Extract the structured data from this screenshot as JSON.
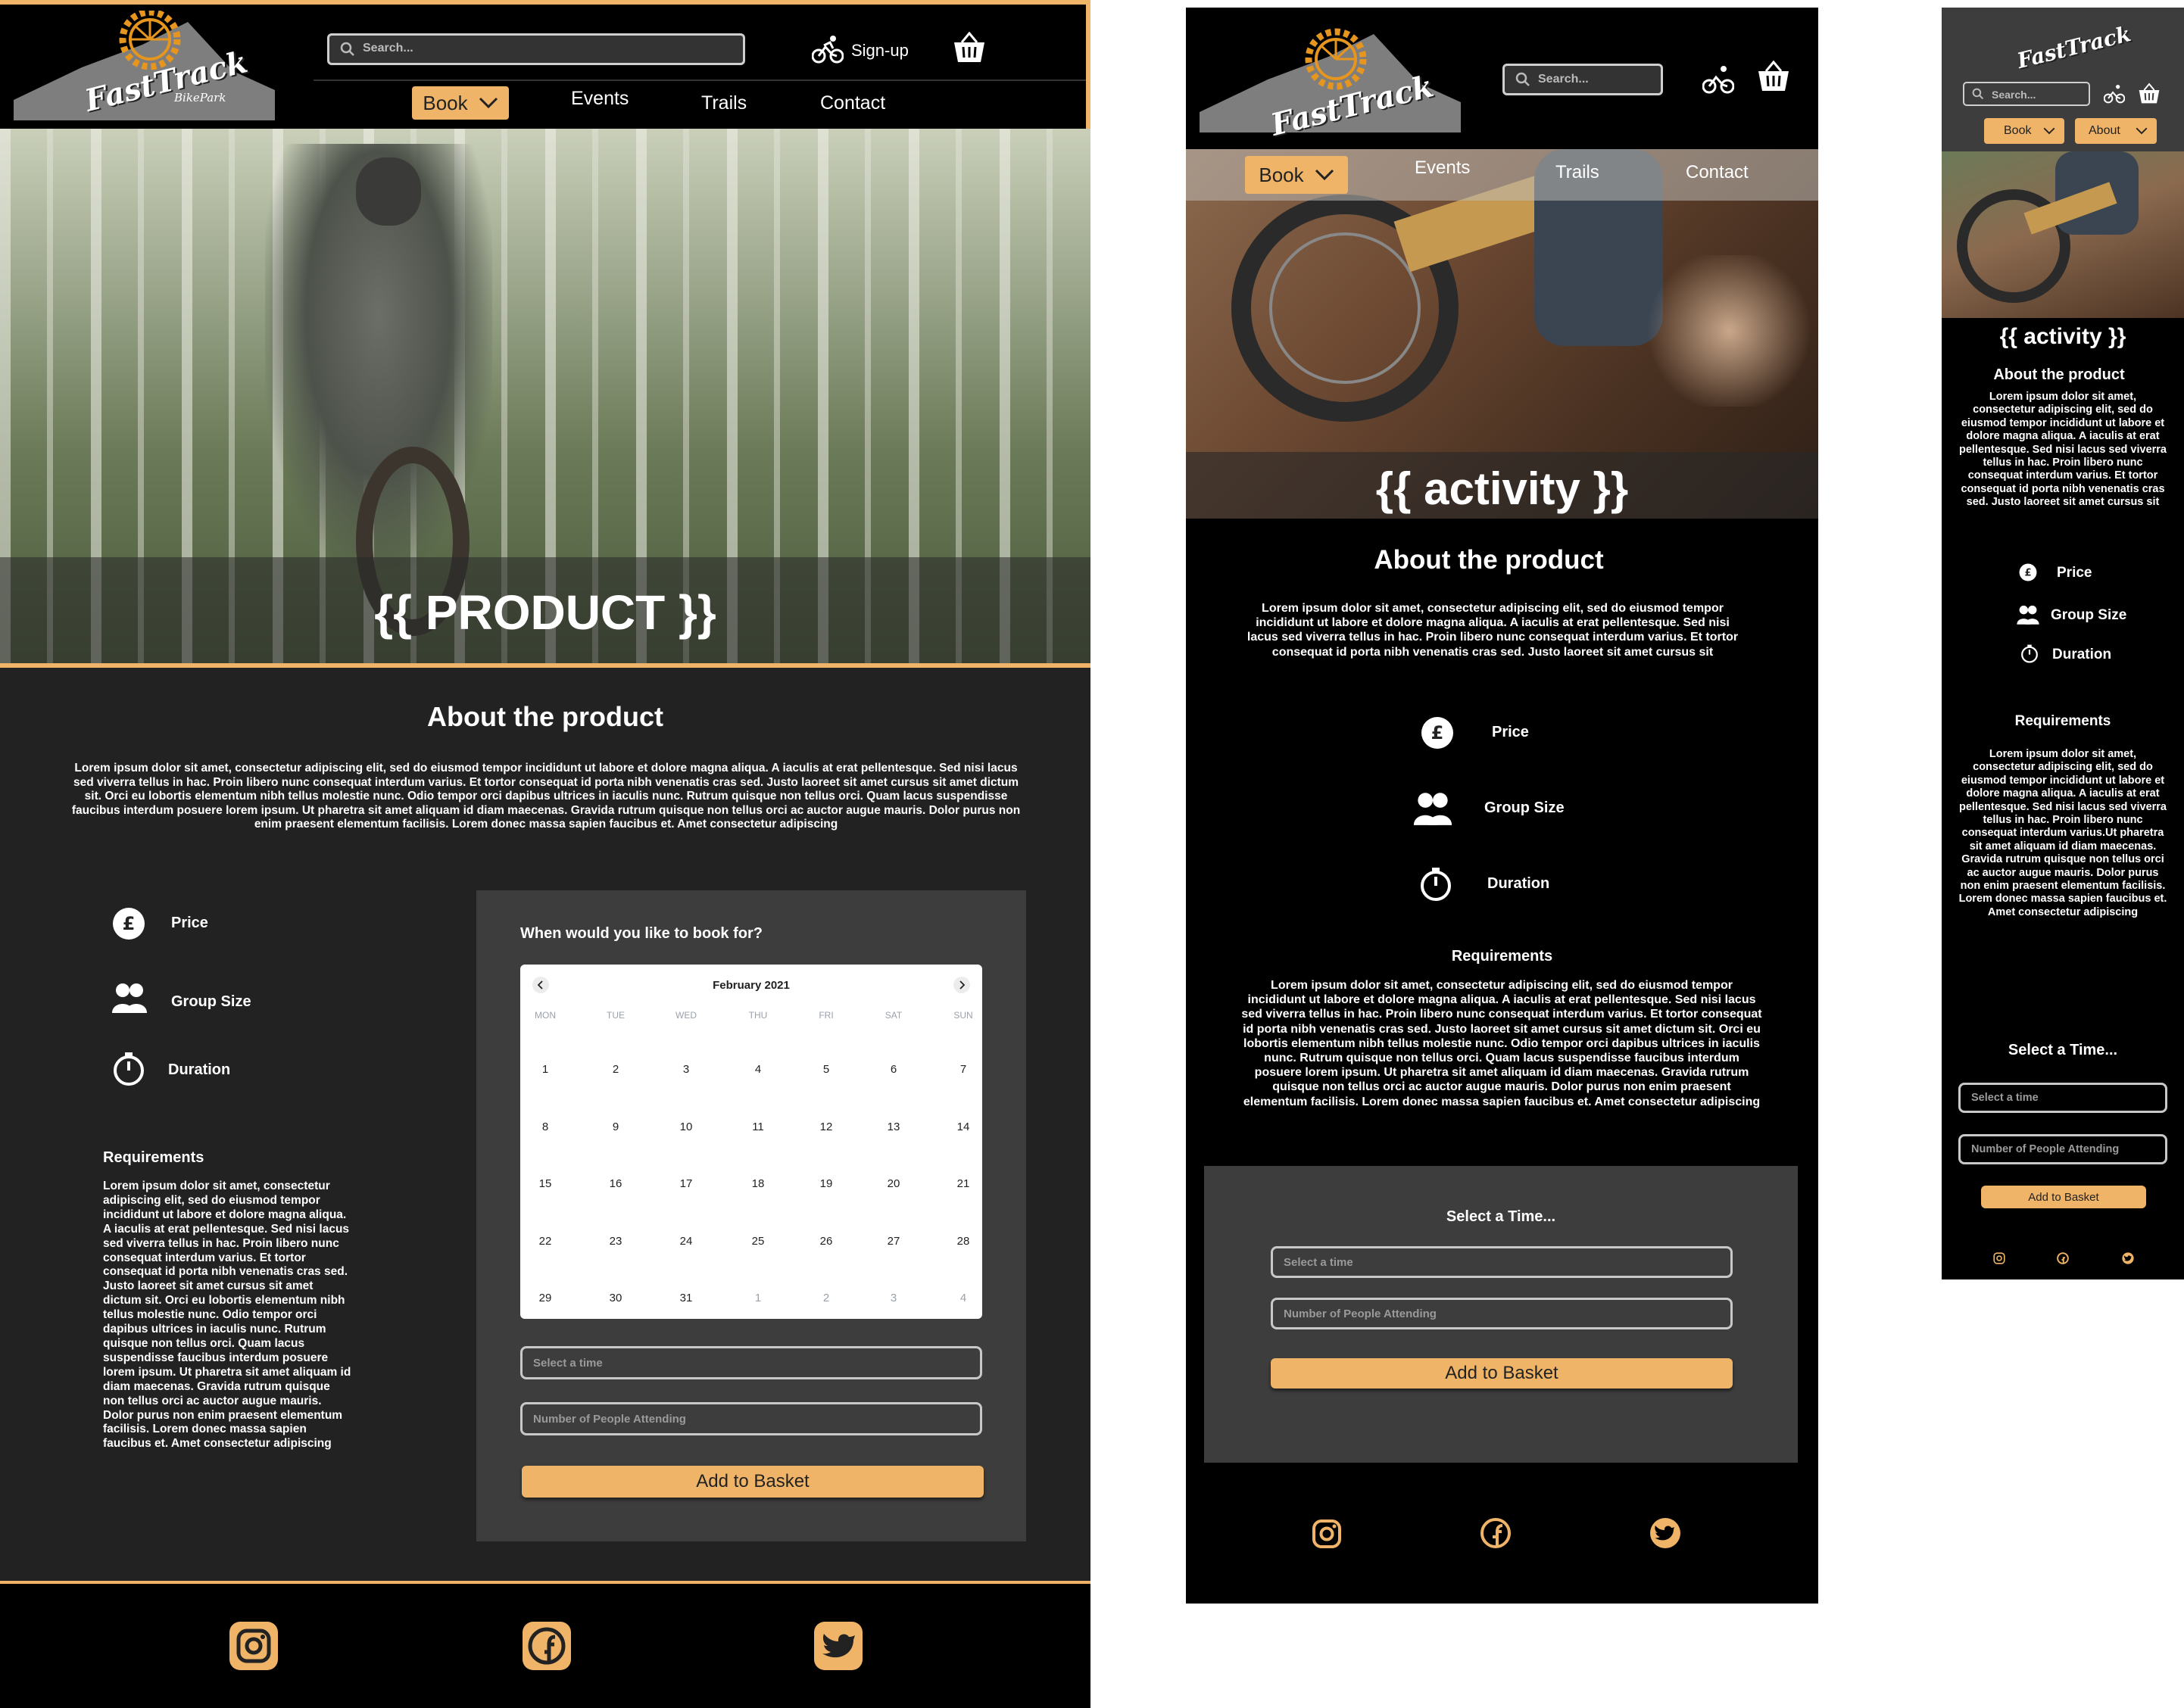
{
  "brand": {
    "name": "FastTrack",
    "sub": "BikePark"
  },
  "search": {
    "placeholder": "Search..."
  },
  "header": {
    "signup": "Sign-up"
  },
  "nav": {
    "book": "Book",
    "events": "Events",
    "trails": "Trails",
    "contact": "Contact",
    "about": "About"
  },
  "desktop": {
    "hero_title": "{{ PRODUCT  }}"
  },
  "tablet": {
    "hero_title": "{{ activity  }}"
  },
  "mobile": {
    "hero_title": "{{ activity  }}"
  },
  "about": {
    "title": "About the product",
    "body_long": "Lorem ipsum dolor sit amet, consectetur adipiscing elit, sed do eiusmod tempor incididunt ut labore et dolore magna aliqua. A iaculis at erat pellentesque. Sed nisi lacus sed viverra tellus in hac. Proin libero nunc consequat interdum varius. Et tortor consequat id porta nibh venenatis cras sed. Justo laoreet sit amet cursus sit amet dictum sit. Orci eu lobortis elementum nibh tellus molestie nunc. Odio tempor orci dapibus ultrices in iaculis nunc. Rutrum quisque non tellus orci. Quam lacus suspendisse faucibus interdum posuere lorem ipsum. Ut pharetra sit amet aliquam id diam maecenas. Gravida rutrum quisque non tellus orci ac auctor augue mauris. Dolor purus non enim praesent elementum facilisis. Lorem donec massa sapien faucibus et. Amet consectetur adipiscing",
    "body_short": "Lorem ipsum dolor sit amet, consectetur adipiscing elit, sed do eiusmod tempor incididunt ut labore et dolore magna aliqua. A iaculis at erat pellentesque. Sed nisi lacus sed viverra tellus in hac. Proin libero nunc consequat interdum varius. Et tortor consequat id porta nibh venenatis cras sed. Justo laoreet sit amet cursus sit"
  },
  "features": {
    "price": "Price",
    "group_size": "Group Size",
    "duration": "Duration"
  },
  "requirements": {
    "title": "Requirements",
    "body": "Lorem ipsum dolor sit amet, consectetur adipiscing elit, sed do eiusmod tempor incididunt ut labore et dolore magna aliqua. A iaculis at erat pellentesque. Sed nisi lacus sed viverra tellus in hac. Proin libero nunc consequat interdum varius. Et tortor consequat id porta nibh venenatis cras sed. Justo laoreet sit amet cursus sit amet dictum sit. Orci eu lobortis elementum nibh tellus molestie nunc. Odio tempor orci dapibus ultrices in iaculis nunc. Rutrum quisque non tellus orci. Quam lacus suspendisse faucibus interdum posuere lorem ipsum. Ut pharetra sit amet aliquam id diam maecenas. Gravida rutrum quisque non tellus orci ac auctor augue mauris. Dolor purus non enim praesent elementum facilisis. Lorem donec massa sapien faucibus et. Amet consectetur adipiscing",
    "body_mobile": "Lorem ipsum dolor sit amet, consectetur adipiscing elit, sed do eiusmod tempor incididunt ut labore et dolore magna aliqua. A iaculis at erat pellentesque. Sed nisi lacus sed viverra tellus in hac. Proin libero nunc consequat interdum varius.Ut pharetra sit amet aliquam id diam maecenas. Gravida rutrum quisque non tellus orci ac auctor augue mauris. Dolor purus non enim praesent elementum facilisis. Lorem donec massa sapien faucibus et. Amet consectetur adipiscing"
  },
  "booking": {
    "question": "When would you like to book for?",
    "select_time_title": "Select a Time...",
    "select_time": "Select a time",
    "people": "Number of People Attending",
    "add": "Add to Basket"
  },
  "calendar": {
    "month": "February 2021",
    "days": [
      "MON",
      "TUE",
      "WED",
      "THU",
      "FRI",
      "SAT",
      "SUN"
    ],
    "weeks": [
      [
        "1",
        "2",
        "3",
        "4",
        "5",
        "6",
        "7"
      ],
      [
        "8",
        "9",
        "10",
        "11",
        "12",
        "13",
        "14"
      ],
      [
        "15",
        "16",
        "17",
        "18",
        "19",
        "20",
        "21"
      ],
      [
        "22",
        "23",
        "24",
        "25",
        "26",
        "27",
        "28"
      ],
      [
        "29",
        "30",
        "31",
        "1",
        "2",
        "3",
        "4"
      ]
    ]
  },
  "social": [
    "instagram-icon",
    "facebook-icon",
    "twitter-icon"
  ],
  "colors": {
    "accent": "#f0b468",
    "dark": "#222222",
    "panel": "#3d3d3d",
    "black": "#000000"
  }
}
